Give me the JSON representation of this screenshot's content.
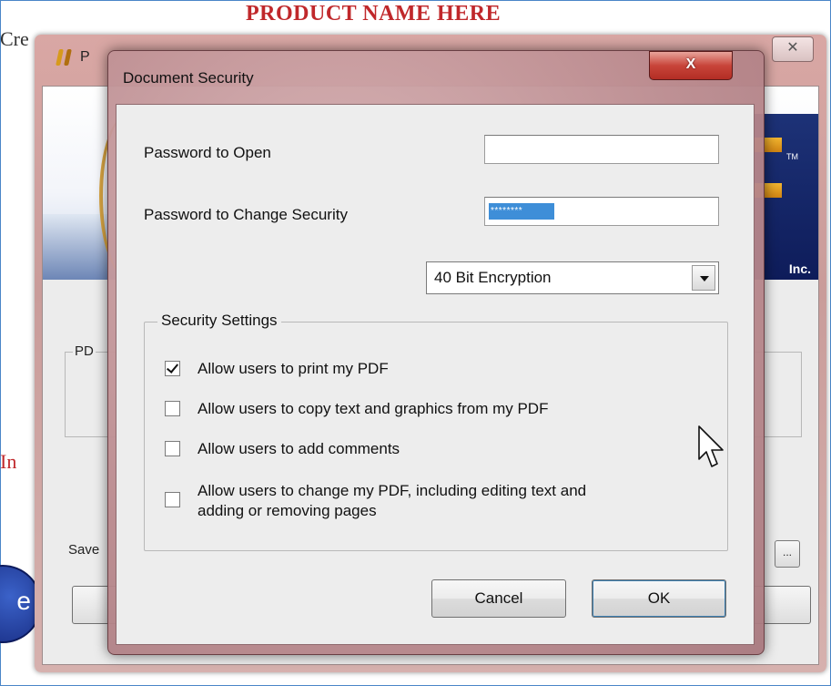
{
  "background_page": {
    "header": "PRODUCT NAME HERE",
    "left_text_top": "Cre",
    "left_text_bottom": "In",
    "circle_letter": "e"
  },
  "app_window": {
    "title": "P",
    "close_label": "✕",
    "banner_tm": "TM",
    "banner_inc": "Inc.",
    "group_label": "PD",
    "save_label": "Save",
    "browse_label": "..."
  },
  "dialog": {
    "title": "Document Security",
    "close_label": "X",
    "password_open_label": "Password to Open",
    "password_open_value": "",
    "password_change_label": "Password to Change Security",
    "password_change_value": "********",
    "encryption_selected": "40 Bit Encryption",
    "security_settings_label": "Security Settings",
    "permissions": [
      {
        "label": "Allow users to print my PDF",
        "checked": true
      },
      {
        "label": "Allow users to copy text and graphics from my PDF",
        "checked": false
      },
      {
        "label": "Allow users to add comments",
        "checked": false
      },
      {
        "label": "Allow users to change my PDF, including editing text and",
        "label_line2": "adding or removing pages",
        "checked": false
      }
    ],
    "cancel_label": "Cancel",
    "ok_label": "OK"
  },
  "colors": {
    "header_red": "#c0282b",
    "dialog_frame": "#c08a8e",
    "selection_blue": "#3e8ed8",
    "close_red": "#c8453a"
  },
  "icons": {
    "app_logo": "app-logo-icon",
    "dropdown_arrow": "chevron-down-icon",
    "checkmark": "checkmark-icon",
    "cursor": "mouse-pointer-icon"
  }
}
